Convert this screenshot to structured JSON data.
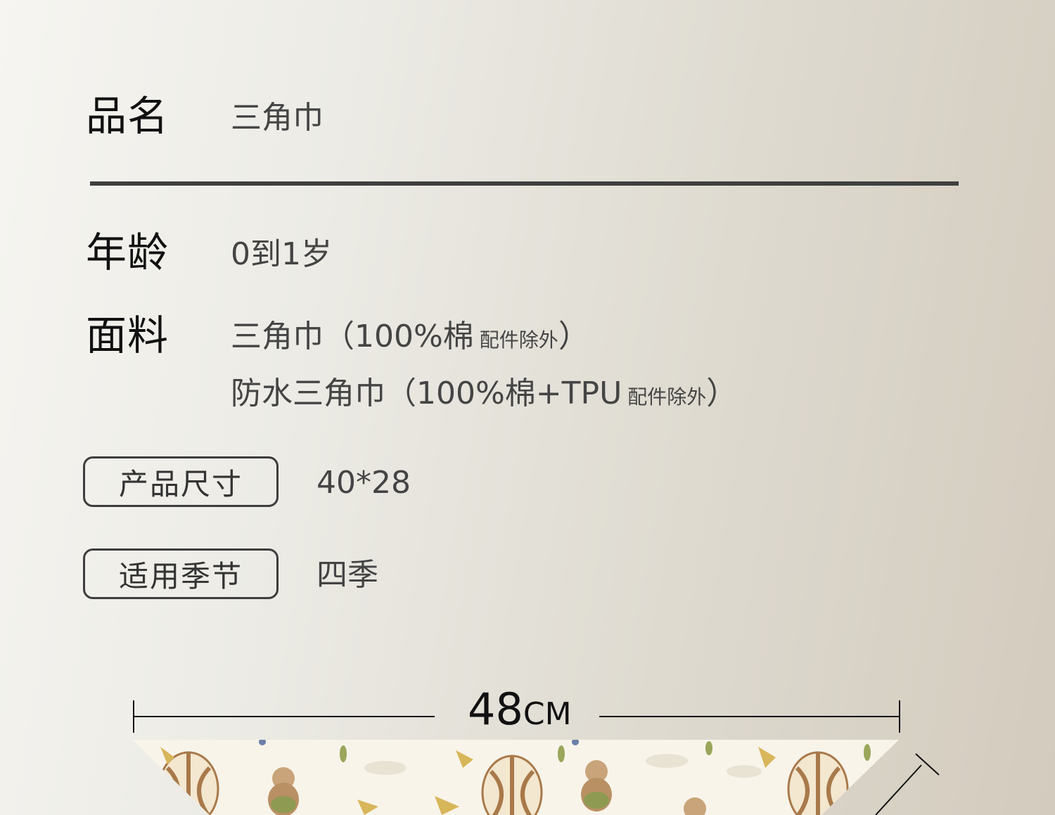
{
  "specs": {
    "name_label": "品名",
    "name_value": "三角巾",
    "age_label": "年龄",
    "age_value": "0到1岁",
    "fabric_label": "面料",
    "fabric_lines": [
      {
        "main": "三角巾（100%棉",
        "note": "配件除外",
        "close": "）"
      },
      {
        "main": "防水三角巾（100%棉+TPU",
        "note": "配件除外",
        "close": "）"
      }
    ]
  },
  "tags": [
    {
      "label": "产品尺寸",
      "value": "40*28"
    },
    {
      "label": "适用季节",
      "value": "四季"
    }
  ],
  "dimension": {
    "value": "48",
    "unit": "CM"
  },
  "colors": {
    "rule": "#3f3f3f",
    "fabric_base": "#f8f4ea",
    "fabric_motif_brown": "#a8794a",
    "fabric_motif_gold": "#d8b65a",
    "fabric_motif_green": "#9aa65a"
  }
}
